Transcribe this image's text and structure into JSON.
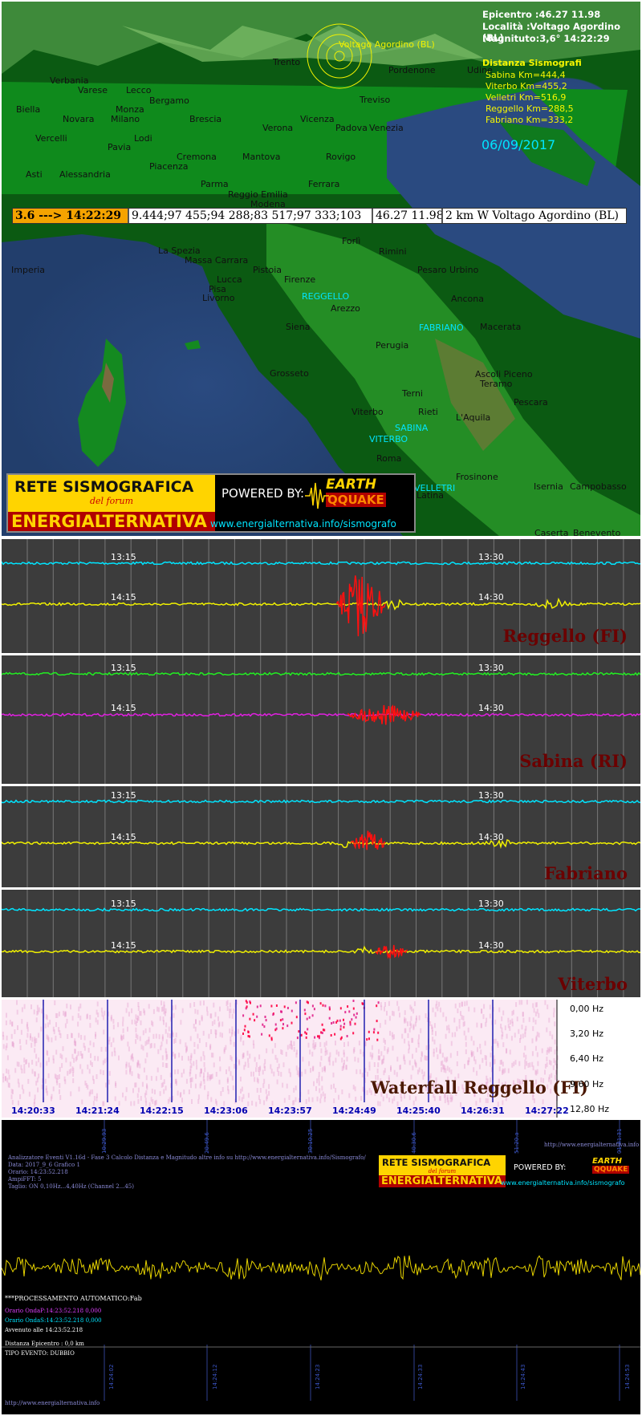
{
  "map": {
    "epicentro": "Epicentro :46.27  11.98",
    "localita": "Località :Voltago Agordino (BL)",
    "magnitudo": "Magnituto:3,6° 14:22:29",
    "distanza_title": "Distanza Sismografi",
    "distances": [
      "Sabina Km=444,4",
      "Viterbo Km=455,2",
      "Velletri Km=516,9",
      "Reggello Km=288,5",
      "Fabriano Km=333,2"
    ],
    "date": "06/09/2017",
    "epicenter_label": "Voltago Agordino (BL)",
    "cities": [
      "Trento",
      "Pordenone",
      "Udine",
      "Verbania",
      "Varese",
      "Lecco",
      "Bergamo",
      "Biella",
      "Novara",
      "Monza",
      "Milano",
      "Brescia",
      "Verona",
      "Vicenza",
      "Padova",
      "Venezia",
      "Treviso",
      "Vercelli",
      "Lodi",
      "Pavia",
      "Cremona",
      "Mantova",
      "Rovigo",
      "Asti",
      "Alessandria",
      "Piacenza",
      "Parma",
      "Reggio Emilia",
      "Modena",
      "Ferrara",
      "Forlì",
      "Rimini",
      "Pesaro Urbino",
      "Imperia",
      "La Spezia",
      "Massa Carrara",
      "Pistoia",
      "Lucca",
      "Pisa",
      "Livorno",
      "Firenze",
      "Arezzo",
      "Ancona",
      "Macerata",
      "Siena",
      "Perugia",
      "Grosseto",
      "Ascoli Piceno",
      "Teramo",
      "Terni",
      "Pescara",
      "Viterbo",
      "Rieti",
      "L'Aquila",
      "Roma",
      "Frosinone",
      "Latina",
      "Isernia",
      "Campobasso",
      "Caserta",
      "Benevento"
    ],
    "stations": [
      "REGGELLO",
      "FABRIANO",
      "SABINA",
      "VITERBO",
      "VELLETRI"
    ],
    "event_bar": {
      "time": "3.6 ---> 14:22:29",
      "data": "9.444;97 455;94 288;83 517;97 333;103",
      "coord": "46.27 11.98",
      "place": "2 km W Voltago Agordino (BL)"
    }
  },
  "banner": {
    "rete": "RETE SISMOGRAFICA",
    "forum": "del forum",
    "energ": "ENERGIALTERNATIVA",
    "powered": "POWERED BY:",
    "logo_earth": "EARTH",
    "logo_quake": "QQUAKE",
    "url": "www.energialternativa.info/sismografo"
  },
  "seismograms": [
    {
      "station": "Reggello (FI)",
      "t1": "13:15",
      "t2": "13:30",
      "t3": "14:15",
      "t4": "14:30"
    },
    {
      "station": "Sabina (RI)",
      "t1": "13:15",
      "t2": "13:30",
      "t3": "14:15",
      "t4": "14:30"
    },
    {
      "station": "Fabriano",
      "t1": "13:15",
      "t2": "13:30",
      "t3": "14:15",
      "t4": "14:30"
    },
    {
      "station": "Viterbo",
      "t1": "13:15",
      "t2": "13:30",
      "t3": "14:15",
      "t4": "14:30"
    }
  ],
  "waterfall": {
    "title": "Waterfall Reggello (FI)",
    "times": [
      "14:20:33",
      "14:21:24",
      "14:22:15",
      "14:23:06",
      "14:23:57",
      "14:24:49",
      "14:25:40",
      "14:26:31",
      "14:27:22"
    ],
    "freqs": [
      "0,00 Hz",
      "3,20 Hz",
      "6,40 Hz",
      "9,60 Hz",
      "12,80 Hz"
    ]
  },
  "analyzer": {
    "ticks_top": [
      "10:29.93",
      "20:49.6",
      "30:10.25",
      "40:30.6",
      "51:20.a",
      "01:41:31"
    ],
    "url_top": "http://www.energialternativa.info",
    "header_lines": [
      "Analizzatore Eventi V1.16d - Fase 3 Calcolo Distanza e Magnitudo altre info su http://www.energialternativa.info/Sismografo/",
      "Data: 2017_9_6 Grafico 1",
      "Orario: 14:23:52.218",
      "AmpiFFT: 5",
      "Taglio: ON 0,10Hz...4,40Hz     (Channel 2...45)"
    ],
    "processing": "***PROCESSAMENTO AUTOMATICO:Fab",
    "onda_p": "Orario OndaP:14:23:52.218  0,000",
    "onda_s": "Orario OndaS:14:23:52.218  0,000",
    "avvenuto": "Avvenuto alle 14:23:52.218",
    "distanza": "Distanza Epicentro : 0,0 km",
    "tipo": "TIPO EVENTO: DUBBIO",
    "ticks_bottom": [
      "14:24:02",
      "14:24:12",
      "14:24:23",
      "14:24:33",
      "14:24:43",
      "14:24:53"
    ],
    "url_bottom": "http://www.energialternativa.info"
  }
}
